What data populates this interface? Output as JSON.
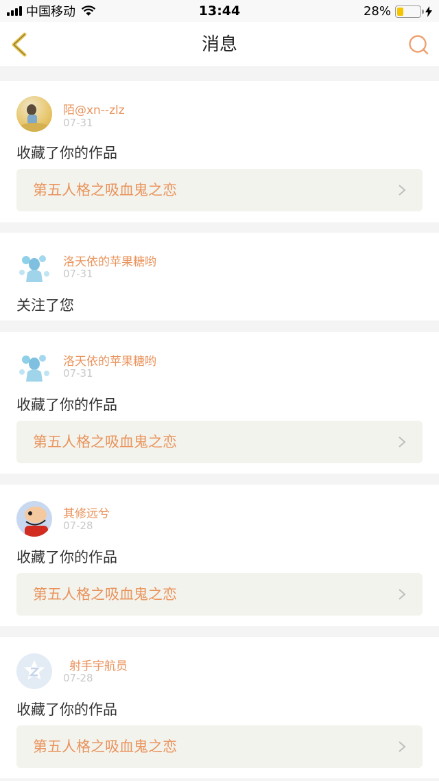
{
  "status_bar": {
    "carrier": "中国移动",
    "time": "13:44",
    "battery_percent": "28%",
    "battery_level": 0.28,
    "colors": {
      "battery": "#f5c400"
    }
  },
  "nav": {
    "title": "消息",
    "back_icon": "chevron-left-icon",
    "search_icon": "search-icon",
    "colors": {
      "back": "#e8c44a",
      "search": "#f0a070"
    }
  },
  "messages": [
    {
      "username": "陌@xn--zlz",
      "date": "07-31",
      "action": "收藏了你的作品",
      "work_title": "第五人格之吸血鬼之恋",
      "avatar": "photo-avatar"
    },
    {
      "username": "洛天依的苹果糖哟",
      "date": "07-31",
      "action": "关注了您",
      "avatar": "anime-avatar"
    },
    {
      "username": "洛天依的苹果糖哟",
      "date": "07-31",
      "action": "收藏了你的作品",
      "work_title": "第五人格之吸血鬼之恋",
      "avatar": "anime-avatar"
    },
    {
      "username": "其修远兮",
      "date": "07-28",
      "action": "收藏了你的作品",
      "work_title": "第五人格之吸血鬼之恋",
      "avatar": "cartoon-avatar"
    },
    {
      "username": "射手宇航员",
      "date": "07-28",
      "action": "收藏了你的作品",
      "work_title": "第五人格之吸血鬼之恋",
      "avatar": "default-qq-avatar"
    }
  ],
  "colors": {
    "accent": "#e9935c",
    "link_bg": "#f3f3ed",
    "date": "#c8c8c8",
    "page_bg": "#f4f4f4"
  }
}
